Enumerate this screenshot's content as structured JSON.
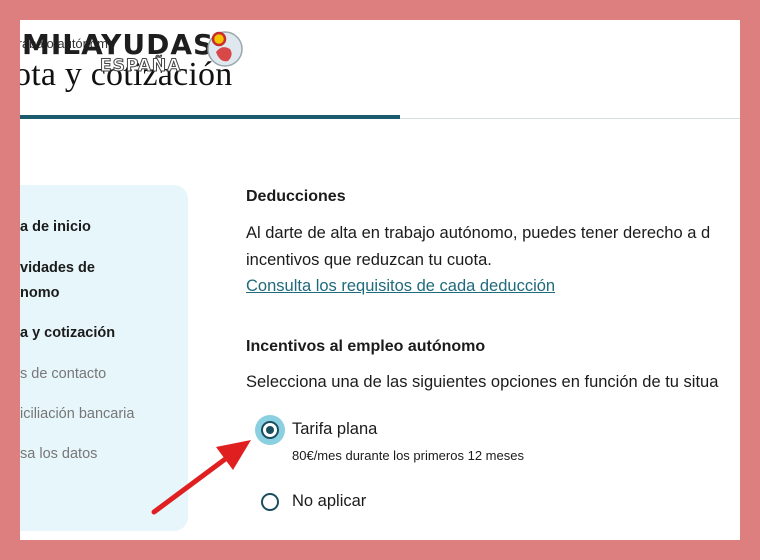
{
  "header": {
    "breadcrumb": "trabajo autónomo",
    "title": "ota y cotización"
  },
  "watermark": {
    "brand": "MILAYUDAS",
    "country": "ESPAÑA",
    "icon": "globe-spain-flag-icon"
  },
  "sidebar": {
    "items": [
      {
        "label": "a de inicio",
        "state": "active"
      },
      {
        "label": "vidades de",
        "state": "active"
      },
      {
        "label": "nomo",
        "state": "active"
      },
      {
        "label": "a y cotización",
        "state": "active"
      },
      {
        "label": "s de contacto",
        "state": "inactive"
      },
      {
        "label": "iciliación bancaria",
        "state": "inactive"
      },
      {
        "label": "sa los datos",
        "state": "inactive"
      }
    ]
  },
  "main": {
    "deducciones": {
      "heading": "Deducciones",
      "line1": "Al darte de alta en trabajo autónomo, puedes tener derecho a d",
      "line2": "incentivos que reduzcan tu cuota.",
      "link": "Consulta los requisitos de cada deducción"
    },
    "incentivos": {
      "heading": "Incentivos al empleo autónomo",
      "description": "Selecciona una de las siguientes opciones en función de tu situa",
      "options": [
        {
          "label": "Tarifa plana",
          "hint": "80€/mes durante los primeros 12 meses",
          "checked": true
        },
        {
          "label": "No aplicar",
          "hint": "",
          "checked": false
        }
      ]
    }
  },
  "colors": {
    "background": "#de7f7f",
    "accent": "#1a5c6e",
    "sidebar_bg": "#e7f6fb",
    "link": "#1f6a7c",
    "arrow": "#e02020"
  }
}
